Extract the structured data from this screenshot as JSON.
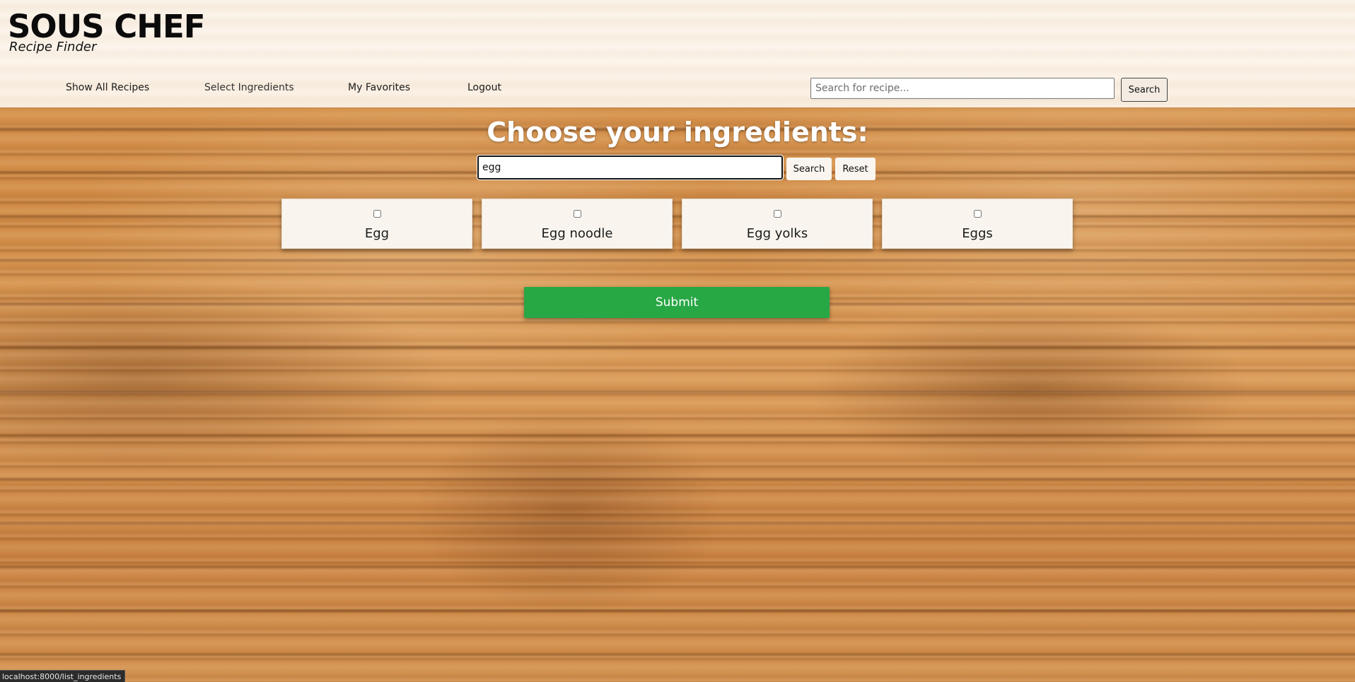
{
  "brand": {
    "title": "SOUS CHEF",
    "subtitle": "Recipe Finder"
  },
  "nav": {
    "items": [
      {
        "label": "Show All Recipes"
      },
      {
        "label": "Select Ingredients"
      },
      {
        "label": "My Favorites"
      },
      {
        "label": "Logout"
      }
    ]
  },
  "top_search": {
    "placeholder": "Search for recipe...",
    "value": "",
    "button_label": "Search"
  },
  "main": {
    "heading": "Choose your ingredients:",
    "search_value": "egg",
    "search_button_label": "Search",
    "reset_button_label": "Reset",
    "ingredients": [
      {
        "label": "Egg",
        "checked": false
      },
      {
        "label": "Egg noodle",
        "checked": false
      },
      {
        "label": "Egg yolks",
        "checked": false
      },
      {
        "label": "Eggs",
        "checked": false
      }
    ],
    "submit_label": "Submit"
  },
  "status_bar": {
    "url": "localhost:8000/list_ingredients"
  },
  "colors": {
    "submit": "#28a745",
    "header_bg": "#fdf6ee",
    "card_bg": "#f9f5ee"
  }
}
